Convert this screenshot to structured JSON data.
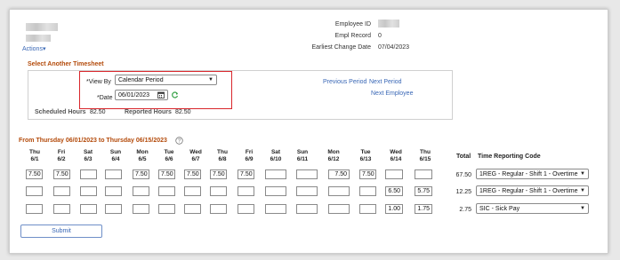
{
  "header": {
    "actions_label": "Actions",
    "actions_caret": "▾",
    "employee_id_label": "Employee ID",
    "empl_record_label": "Empl Record",
    "empl_record_value": "0",
    "earliest_change_label": "Earliest Change Date",
    "earliest_change_value": "07/04/2023"
  },
  "select_timesheet": {
    "title": "Select Another Timesheet",
    "view_by_label": "*View By",
    "view_by_value": "Calendar Period",
    "date_label": "*Date",
    "date_value": "06/01/2023",
    "previous_period": "Previous Period",
    "next_period": "Next Period",
    "next_employee": "Next Employee",
    "scheduled_hours_label": "Scheduled Hours",
    "scheduled_hours_value": "82.50",
    "reported_hours_label": "Reported Hours",
    "reported_hours_value": "82.50"
  },
  "period": {
    "title": "From Thursday 06/01/2023 to Thursday 06/15/2023",
    "help": "?"
  },
  "grid": {
    "days": [
      {
        "dow": "Thu",
        "date": "6/1"
      },
      {
        "dow": "Fri",
        "date": "6/2"
      },
      {
        "dow": "Sat",
        "date": "6/3"
      },
      {
        "dow": "Sun",
        "date": "6/4"
      },
      {
        "dow": "Mon",
        "date": "6/5"
      },
      {
        "dow": "Tue",
        "date": "6/6"
      },
      {
        "dow": "Wed",
        "date": "6/7"
      },
      {
        "dow": "Thu",
        "date": "6/8"
      },
      {
        "dow": "Fri",
        "date": "6/9"
      },
      {
        "dow": "Sat",
        "date": "6/10"
      },
      {
        "dow": "Sun",
        "date": "6/11"
      },
      {
        "dow": "Mon",
        "date": "6/12"
      },
      {
        "dow": "Tue",
        "date": "6/13"
      },
      {
        "dow": "Wed",
        "date": "6/14"
      },
      {
        "dow": "Thu",
        "date": "6/15"
      }
    ],
    "total_header": "Total",
    "trc_header": "Time Reporting Code",
    "rows": [
      {
        "values": [
          "7.50",
          "7.50",
          "",
          "",
          "7.50",
          "7.50",
          "7.50",
          "7.50",
          "7.50",
          "",
          "",
          "7.50",
          "7.50",
          "",
          ""
        ],
        "total": "67.50",
        "trc": "1REG - Regular - Shift 1 - Overtime"
      },
      {
        "values": [
          "",
          "",
          "",
          "",
          "",
          "",
          "",
          "",
          "",
          "",
          "",
          "",
          "",
          "6.50",
          "5.75"
        ],
        "total": "12.25",
        "trc": "1REG - Regular - Shift 1 - Overtime"
      },
      {
        "values": [
          "",
          "",
          "",
          "",
          "",
          "",
          "",
          "",
          "",
          "",
          "",
          "",
          "",
          "1.00",
          "1.75"
        ],
        "total": "2.75",
        "trc": "SIC - Sick Pay"
      }
    ]
  },
  "submit_label": "Submit",
  "colors": {
    "accent": "#3a68b6",
    "section_title": "#b34a0a",
    "highlight_border": "#d9262b"
  }
}
